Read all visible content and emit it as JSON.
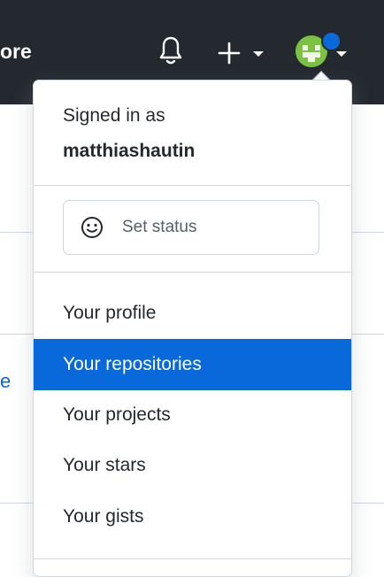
{
  "header": {
    "partial_label": "ore",
    "icons": {
      "notifications": "bell-icon",
      "create": "plus-icon",
      "create_caret": "chevron-down-icon",
      "avatar": "avatar",
      "avatar_caret": "chevron-down-icon"
    }
  },
  "background": {
    "partial_link": "e"
  },
  "dropdown": {
    "signed_in_label": "Signed in as",
    "username": "matthiashautin",
    "set_status_label": "Set status",
    "items": [
      {
        "label": "Your profile"
      },
      {
        "label": "Your repositories"
      },
      {
        "label": "Your projects"
      },
      {
        "label": "Your stars"
      },
      {
        "label": "Your gists"
      }
    ],
    "active_item": "Your repositories"
  },
  "colors": {
    "header_bg": "#24292f",
    "accent": "#0969da",
    "border": "#d0d7de",
    "text": "#24292f",
    "muted_text": "#57606a"
  }
}
